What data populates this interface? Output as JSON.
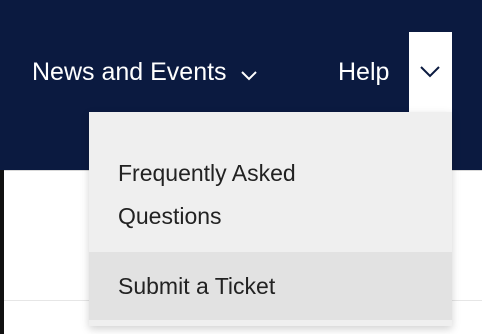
{
  "navbar": {
    "background": "#0b1a40",
    "items": [
      {
        "label": "News and Events",
        "icon": "chevron-down-icon",
        "expanded": false
      },
      {
        "label": "Help",
        "icon": "chevron-down-icon",
        "expanded": true
      }
    ]
  },
  "help_dropdown": {
    "items": [
      {
        "label": "Frequently Asked Questions"
      },
      {
        "label": "Submit a Ticket",
        "hovered": true
      }
    ]
  }
}
